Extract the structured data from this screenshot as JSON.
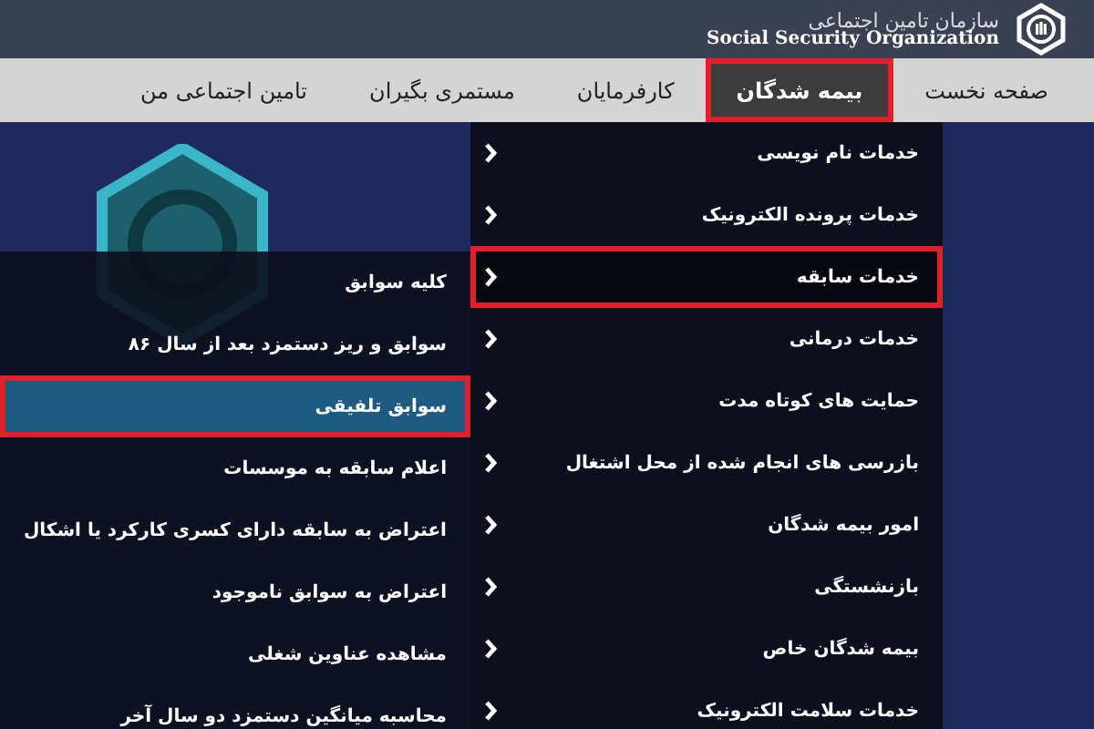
{
  "header": {
    "title": "سازمان تامین اجتماعی",
    "subtitle": "Social Security Organization"
  },
  "nav": [
    {
      "label": "صفحه نخست",
      "selected": false
    },
    {
      "label": "بیمه شدگان",
      "selected": true
    },
    {
      "label": "کارفرمایان",
      "selected": false
    },
    {
      "label": "مستمری بگیران",
      "selected": false
    },
    {
      "label": "تامین اجتماعی من",
      "selected": false
    }
  ],
  "menu": [
    {
      "label": "خدمات نام نویسی",
      "selected": false
    },
    {
      "label": "خدمات پرونده الکترونیک",
      "selected": false
    },
    {
      "label": "خدمات سابقه",
      "selected": true
    },
    {
      "label": "خدمات درمانی",
      "selected": false
    },
    {
      "label": "حمایت های کوتاه مدت",
      "selected": false
    },
    {
      "label": "بازرسی های انجام شده از محل اشتغال",
      "selected": false
    },
    {
      "label": "امور بیمه شدگان",
      "selected": false
    },
    {
      "label": "بازنشستگی",
      "selected": false
    },
    {
      "label": "بیمه شدگان خاص",
      "selected": false
    },
    {
      "label": "خدمات سلامت الکترونیک",
      "selected": false
    }
  ],
  "submenu": [
    {
      "label": "کلیه سوابق",
      "selected": false
    },
    {
      "label": "سوابق و ریز دستمزد بعد از سال ۸۶",
      "selected": false
    },
    {
      "label": "سوابق تلفیقی",
      "selected": true
    },
    {
      "label": "اعلام سابقه به موسسات",
      "selected": false
    },
    {
      "label": "اعتراض به سابقه دارای کسری کارکرد یا اشکال",
      "selected": false
    },
    {
      "label": "اعتراض به سوابق ناموجود",
      "selected": false
    },
    {
      "label": "مشاهده عناوین شغلی",
      "selected": false
    },
    {
      "label": "محاسبه میانگین دستمزد دو سال آخر",
      "selected": false
    }
  ]
}
